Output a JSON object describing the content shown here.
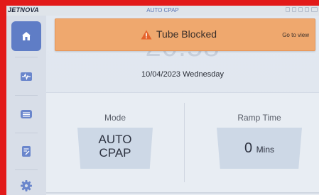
{
  "topbar": {
    "brand": "JETNOVA",
    "mode_title": "AUTO CPAP",
    "status_icons": [
      "alarm-bell-icon",
      "wifi-icon",
      "bluetooth-icon",
      "sd-card-icon",
      "battery-icon"
    ]
  },
  "sidebar": {
    "items": [
      {
        "name": "home",
        "icon": "home-icon",
        "active": true
      },
      {
        "name": "monitor",
        "icon": "waveform-icon",
        "active": false
      },
      {
        "name": "data",
        "icon": "list-icon",
        "active": false
      },
      {
        "name": "report",
        "icon": "report-icon",
        "active": false
      },
      {
        "name": "settings",
        "icon": "gear-icon",
        "active": false
      }
    ]
  },
  "alert": {
    "message": "Tube Blocked",
    "action": "Go to view",
    "color": "#efa86e"
  },
  "main": {
    "time": "20:58",
    "date": "10/04/2023 Wednesday"
  },
  "params": {
    "mode": {
      "label": "Mode",
      "value_line1": "AUTO",
      "value_line2": "CPAP"
    },
    "ramp": {
      "label": "Ramp Time",
      "value": "0",
      "unit": "Mins"
    }
  },
  "colors": {
    "accent": "#5f7dc6",
    "frame": "#e21a1a",
    "warning": "#e5622b"
  }
}
